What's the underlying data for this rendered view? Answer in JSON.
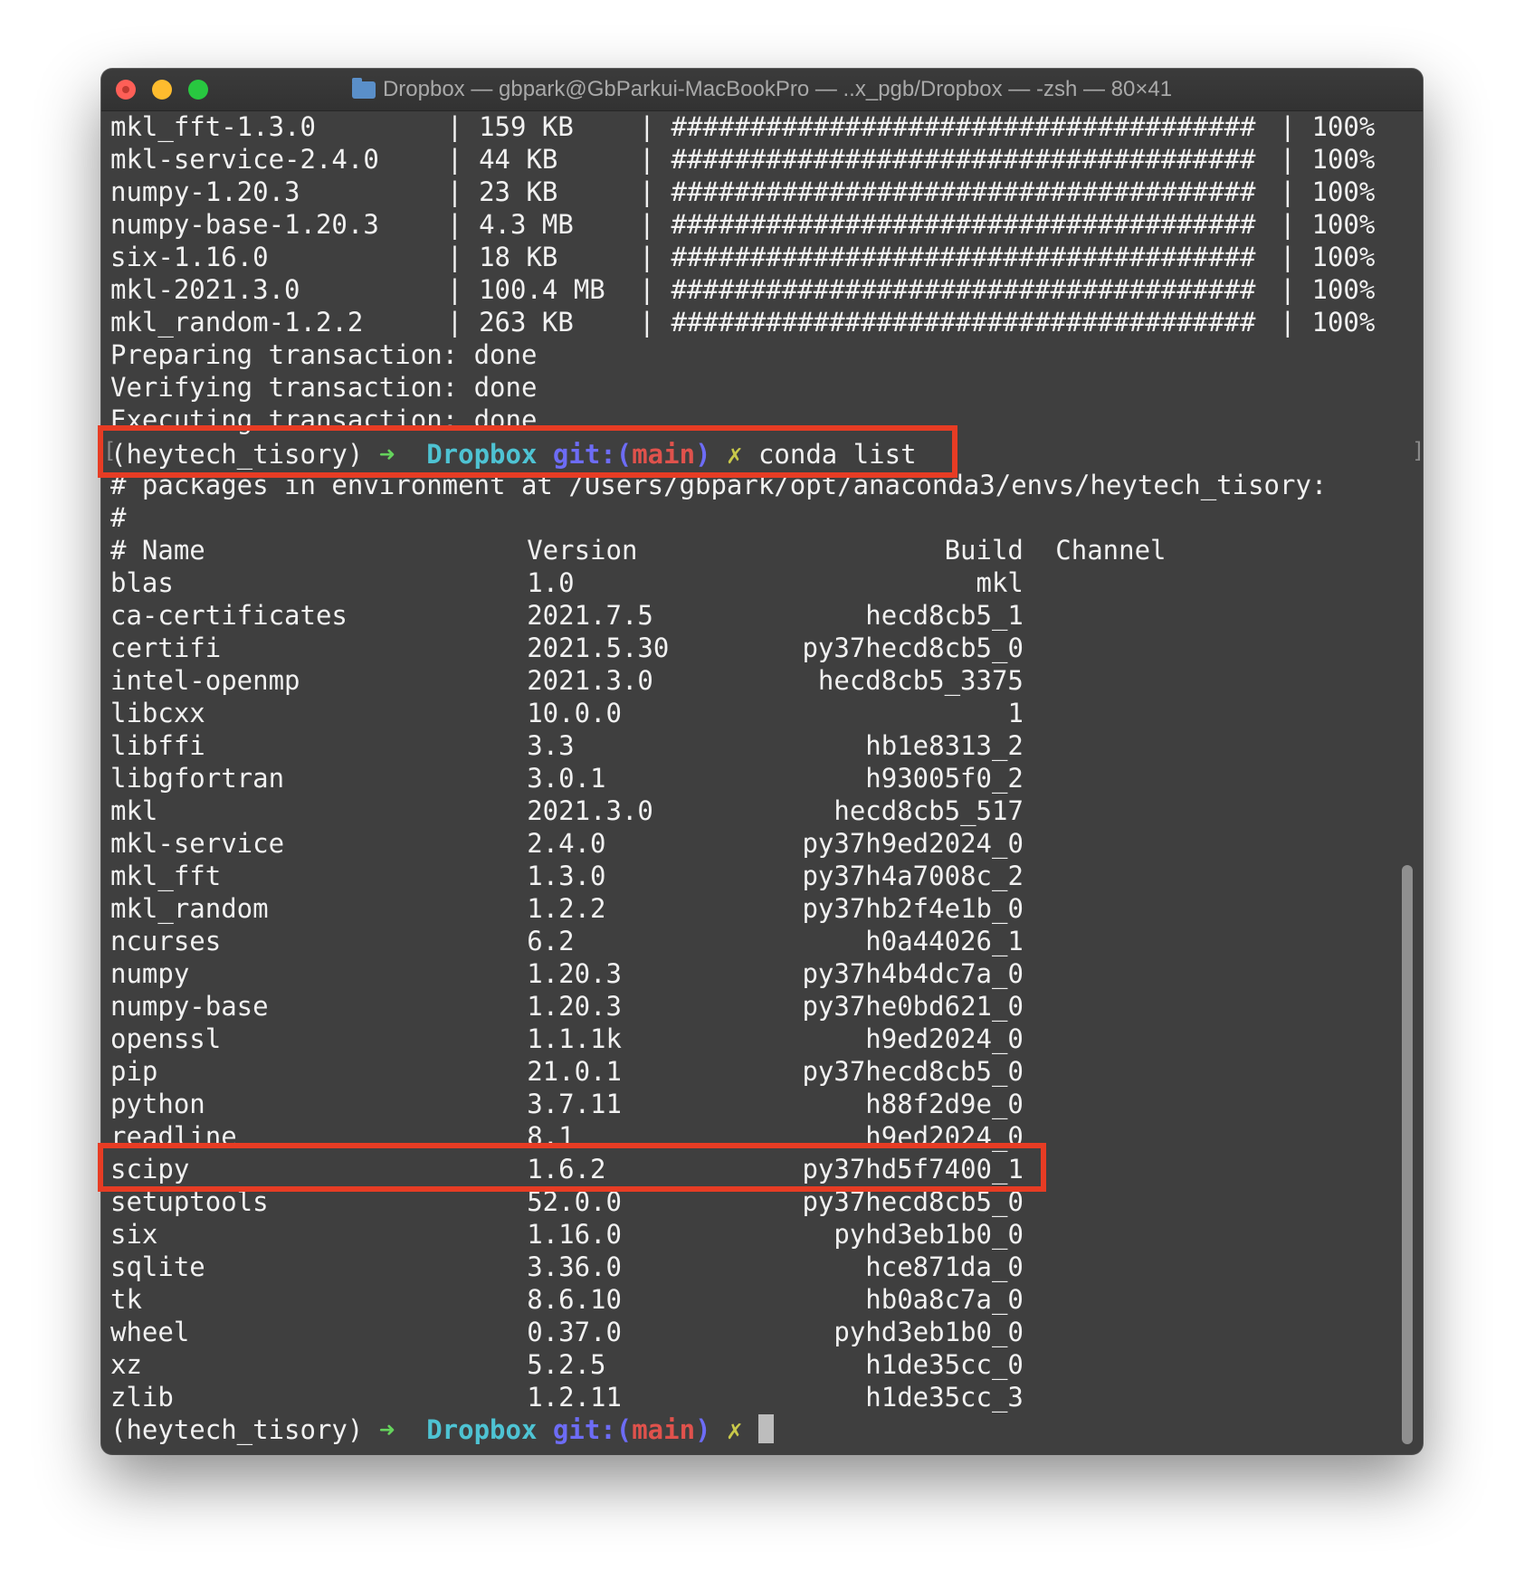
{
  "window": {
    "title": "Dropbox — gbpark@GbParkui-MacBookPro — ..x_pgb/Dropbox — -zsh — 80×41",
    "folder_icon": "folder-icon"
  },
  "download_rows": [
    {
      "name": "mkl_fft-1.3.0",
      "size": "159 KB",
      "bar": "#####################################",
      "pct": "100%"
    },
    {
      "name": "mkl-service-2.4.0",
      "size": "44 KB",
      "bar": "#####################################",
      "pct": "100%"
    },
    {
      "name": "numpy-1.20.3",
      "size": "23 KB",
      "bar": "#####################################",
      "pct": "100%"
    },
    {
      "name": "numpy-base-1.20.3",
      "size": "4.3 MB",
      "bar": "#####################################",
      "pct": "100%"
    },
    {
      "name": "six-1.16.0",
      "size": "18 KB",
      "bar": "#####################################",
      "pct": "100%"
    },
    {
      "name": "mkl-2021.3.0",
      "size": "100.4 MB",
      "bar": "#####################################",
      "pct": "100%"
    },
    {
      "name": "mkl_random-1.2.2",
      "size": "263 KB",
      "bar": "#####################################",
      "pct": "100%"
    }
  ],
  "status_lines": [
    "Preparing transaction: done",
    "Verifying transaction: done",
    "Executing transaction: done"
  ],
  "prompt1": {
    "env": "(heytech_tisory)",
    "arrow": "➜",
    "dir": "Dropbox",
    "git_prefix": "git:(",
    "branch": "main",
    "git_suffix": ")",
    "dirty": "✗",
    "command": "conda list"
  },
  "header_lines": [
    "# packages in environment at /Users/gbpark/opt/anaconda3/envs/heytech_tisory:",
    "#"
  ],
  "table_header": {
    "name": "# Name",
    "version": "Version",
    "build": "Build",
    "channel": "Channel"
  },
  "packages": [
    {
      "name": "blas",
      "version": "1.0",
      "build": "mkl"
    },
    {
      "name": "ca-certificates",
      "version": "2021.7.5",
      "build": "hecd8cb5_1"
    },
    {
      "name": "certifi",
      "version": "2021.5.30",
      "build": "py37hecd8cb5_0"
    },
    {
      "name": "intel-openmp",
      "version": "2021.3.0",
      "build": "hecd8cb5_3375"
    },
    {
      "name": "libcxx",
      "version": "10.0.0",
      "build": "1"
    },
    {
      "name": "libffi",
      "version": "3.3",
      "build": "hb1e8313_2"
    },
    {
      "name": "libgfortran",
      "version": "3.0.1",
      "build": "h93005f0_2"
    },
    {
      "name": "mkl",
      "version": "2021.3.0",
      "build": "hecd8cb5_517"
    },
    {
      "name": "mkl-service",
      "version": "2.4.0",
      "build": "py37h9ed2024_0"
    },
    {
      "name": "mkl_fft",
      "version": "1.3.0",
      "build": "py37h4a7008c_2"
    },
    {
      "name": "mkl_random",
      "version": "1.2.2",
      "build": "py37hb2f4e1b_0"
    },
    {
      "name": "ncurses",
      "version": "6.2",
      "build": "h0a44026_1"
    },
    {
      "name": "numpy",
      "version": "1.20.3",
      "build": "py37h4b4dc7a_0"
    },
    {
      "name": "numpy-base",
      "version": "1.20.3",
      "build": "py37he0bd621_0"
    },
    {
      "name": "openssl",
      "version": "1.1.1k",
      "build": "h9ed2024_0"
    },
    {
      "name": "pip",
      "version": "21.0.1",
      "build": "py37hecd8cb5_0"
    },
    {
      "name": "python",
      "version": "3.7.11",
      "build": "h88f2d9e_0"
    },
    {
      "name": "readline",
      "version": "8.1",
      "build": "h9ed2024_0"
    },
    {
      "name": "scipy",
      "version": "1.6.2",
      "build": "py37hd5f7400_1"
    },
    {
      "name": "setuptools",
      "version": "52.0.0",
      "build": "py37hecd8cb5_0"
    },
    {
      "name": "six",
      "version": "1.16.0",
      "build": "pyhd3eb1b0_0"
    },
    {
      "name": "sqlite",
      "version": "3.36.0",
      "build": "hce871da_0"
    },
    {
      "name": "tk",
      "version": "8.6.10",
      "build": "hb0a8c7a_0"
    },
    {
      "name": "wheel",
      "version": "0.37.0",
      "build": "pyhd3eb1b0_0"
    },
    {
      "name": "xz",
      "version": "5.2.5",
      "build": "h1de35cc_0"
    },
    {
      "name": "zlib",
      "version": "1.2.11",
      "build": "h1de35cc_3"
    }
  ],
  "prompt2": {
    "env": "(heytech_tisory)",
    "arrow": "➜",
    "dir": "Dropbox",
    "git_prefix": "git:(",
    "branch": "main",
    "git_suffix": ")",
    "dirty": "✗"
  },
  "colors": {
    "background": "#3f3f3f",
    "text": "#f1f1f1",
    "prompt_arrow": "#65d35c",
    "prompt_dir": "#4ec3d3",
    "prompt_git": "#6d6cf6",
    "prompt_branch": "#e0524c",
    "prompt_dirty": "#c9c94a",
    "highlight_box": "#e73c24"
  }
}
